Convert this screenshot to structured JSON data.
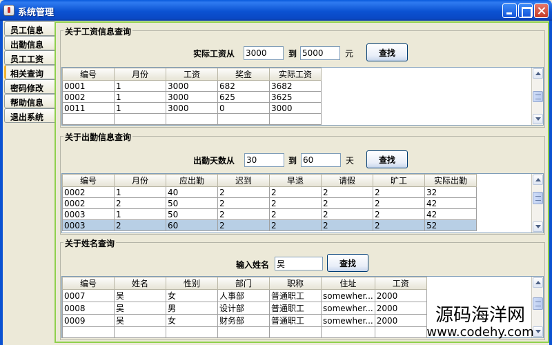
{
  "window": {
    "title": "系统管理"
  },
  "tabs": [
    "员工信息",
    "出勤信息",
    "员工工资",
    "相关查询",
    "密码修改",
    "帮助信息",
    "退出系统"
  ],
  "salary_query": {
    "title": "关于工资信息查询",
    "range_label": "实际工资从",
    "from": "3000",
    "to_label": "到",
    "to": "5000",
    "unit": "元",
    "button": "查找",
    "columns": [
      "编号",
      "月份",
      "工资",
      "奖金",
      "实际工资"
    ],
    "rows": [
      [
        "0001",
        "1",
        "3000",
        "682",
        "3682"
      ],
      [
        "0002",
        "1",
        "3000",
        "625",
        "3625"
      ],
      [
        "0011",
        "1",
        "3000",
        "0",
        "3000"
      ]
    ]
  },
  "attendance_query": {
    "title": "关于出勤信息查询",
    "range_label": "出勤天数从",
    "from": "30",
    "to_label": "到",
    "to": "60",
    "unit": "天",
    "button": "查找",
    "columns": [
      "编号",
      "月份",
      "应出勤",
      "迟到",
      "早退",
      "请假",
      "旷工",
      "实际出勤"
    ],
    "rows": [
      [
        "0002",
        "1",
        "40",
        "2",
        "2",
        "2",
        "2",
        "32"
      ],
      [
        "0002",
        "2",
        "50",
        "2",
        "2",
        "2",
        "2",
        "42"
      ],
      [
        "0003",
        "1",
        "50",
        "2",
        "2",
        "2",
        "2",
        "42"
      ],
      [
        "0003",
        "2",
        "60",
        "2",
        "2",
        "2",
        "2",
        "52"
      ]
    ],
    "selected_row": 3
  },
  "name_query": {
    "title": "关于姓名查询",
    "input_label": "输入姓名",
    "value": "吴",
    "button": "查找",
    "columns": [
      "编号",
      "姓名",
      "性别",
      "部门",
      "职称",
      "住址",
      "工资"
    ],
    "rows": [
      [
        "0007",
        "吴",
        "女",
        "人事部",
        "普通职工",
        "somewher...",
        "2000"
      ],
      [
        "0008",
        "吴",
        "男",
        "设计部",
        "普通职工",
        "somewher...",
        "2000"
      ],
      [
        "0009",
        "吴",
        "女",
        "财务部",
        "普通职工",
        "somewher...",
        "2000"
      ]
    ]
  },
  "watermark": {
    "name": "源码海洋网",
    "url": "www.codehy.com"
  },
  "colors": {
    "titlebar": "#0b52d2",
    "panel_border": "#8fd04c",
    "selection": "#b8cfe5"
  }
}
